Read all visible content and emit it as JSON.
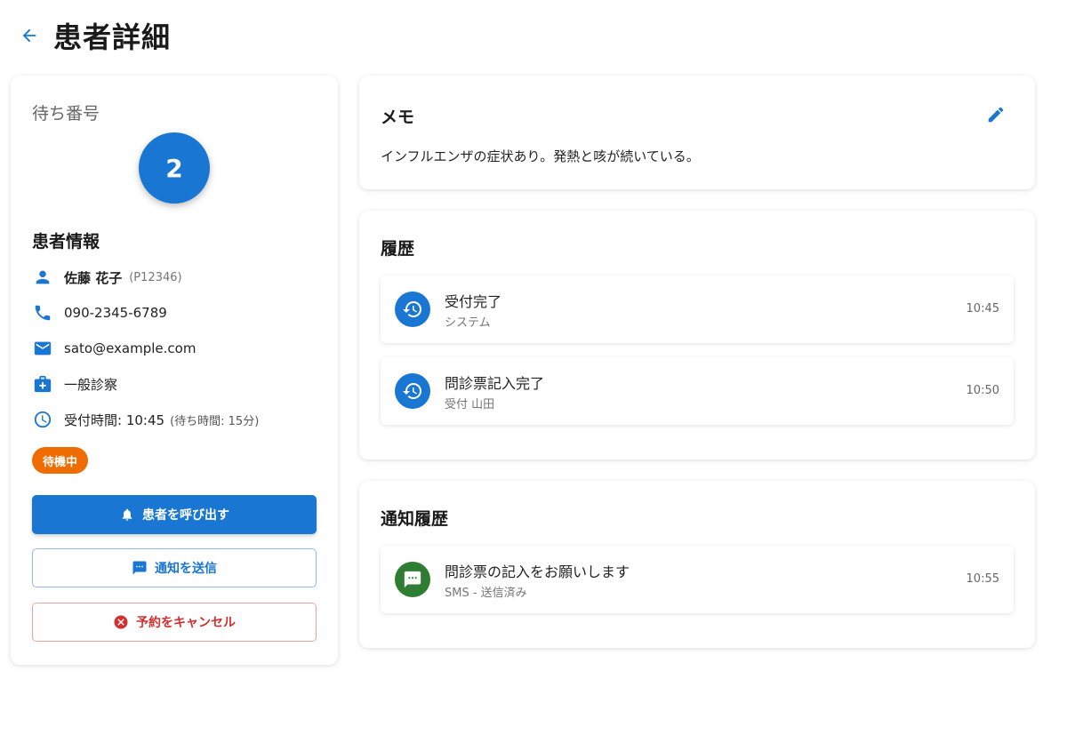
{
  "header": {
    "title": "患者詳細"
  },
  "queue": {
    "label": "待ち番号",
    "number": "2"
  },
  "patient_info": {
    "title": "患者情報",
    "name": "佐藤 花子",
    "id": "(P12346)",
    "phone": "090-2345-6789",
    "email": "sato@example.com",
    "department": "一般診察",
    "reception_time": "受付時間: 10:45",
    "wait_time": "(待ち時間: 15分)",
    "status": "待機中"
  },
  "actions": {
    "call": "患者を呼び出す",
    "notify": "通知を送信",
    "cancel": "予約をキャンセル"
  },
  "memo": {
    "title": "メモ",
    "text": "インフルエンザの症状あり。発熱と咳が続いている。"
  },
  "history": {
    "title": "履歴",
    "items": [
      {
        "title": "受付完了",
        "subtitle": "システム",
        "time": "10:45"
      },
      {
        "title": "問診票記入完了",
        "subtitle": "受付 山田",
        "time": "10:50"
      }
    ]
  },
  "notifications": {
    "title": "通知履歴",
    "items": [
      {
        "title": "問診票の記入をお願いします",
        "subtitle": "SMS - 送信済み",
        "time": "10:55"
      }
    ]
  },
  "colors": {
    "primary": "#1976d2",
    "warning": "#ef6c00",
    "danger": "#d32f2f",
    "success": "#2e7d32"
  },
  "icons": [
    "arrow-left-icon",
    "person-icon",
    "phone-icon",
    "email-icon",
    "medical-bag-icon",
    "clock-icon",
    "bell-icon",
    "message-icon",
    "cancel-circle-icon",
    "edit-pencil-icon",
    "history-icon",
    "chat-icon"
  ]
}
